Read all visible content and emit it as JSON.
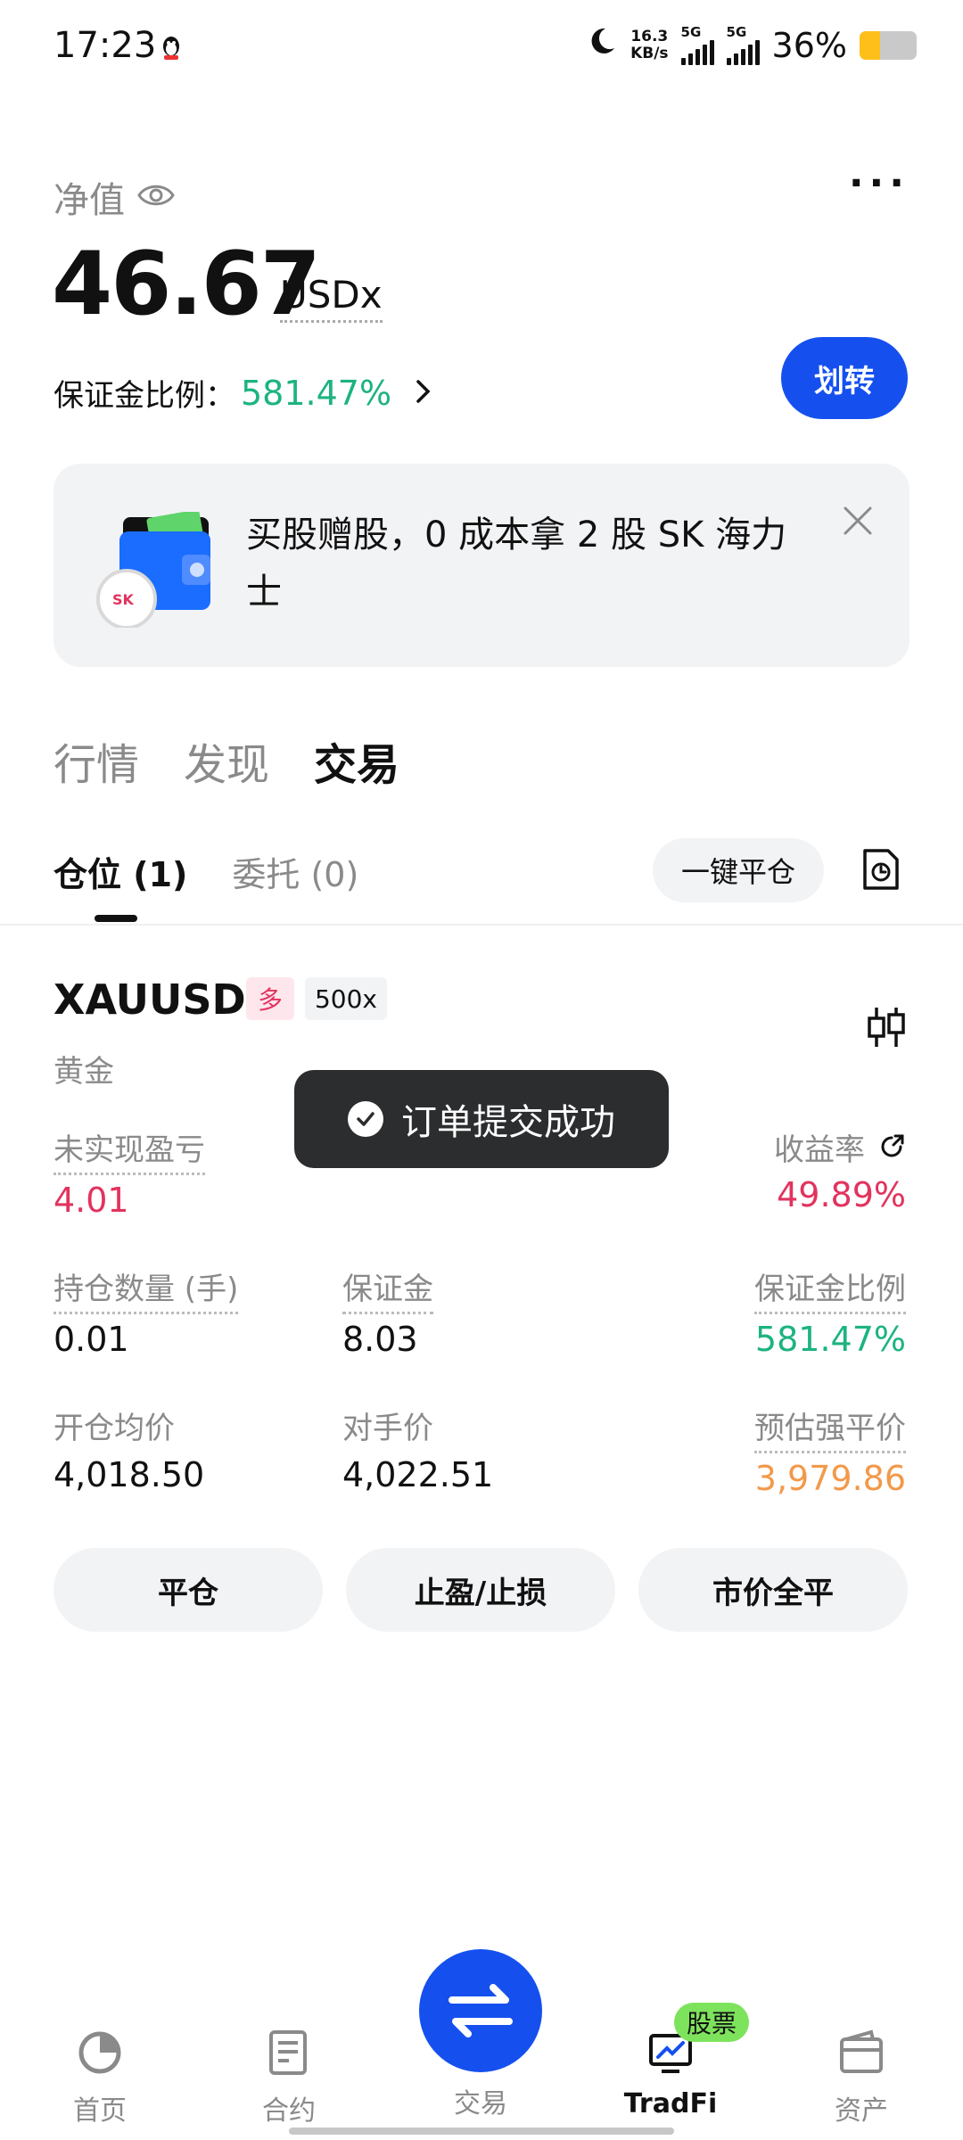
{
  "status_bar": {
    "time": "17:23",
    "speed_value": "16.3",
    "speed_unit": "KB/s",
    "network_1": "5G",
    "network_2": "5G",
    "battery": "36%",
    "battery_fraction": 0.36
  },
  "header": {
    "net_value_label": "净值",
    "balance": "46.67",
    "currency": "USDx",
    "margin_ratio_label": "保证金比例：",
    "margin_ratio_value": "581.47%",
    "transfer_button": "划转"
  },
  "banner": {
    "text": "买股赠股，0 成本拿 2 股 SK 海力士"
  },
  "main_tabs": [
    "行情",
    "发现",
    "交易"
  ],
  "main_tab_active": "交易",
  "sub_tabs": {
    "positions": "仓位 (1)",
    "orders": "委托 (0)",
    "close_all": "一键平仓"
  },
  "position": {
    "symbol": "XAUUSD",
    "side_tag": "多",
    "leverage": "500x",
    "name": "黄金",
    "unrealized_pnl_label": "未实现盈亏",
    "unrealized_pnl": "4.01",
    "roe_label": "收益率",
    "roe": "49.89%",
    "size_label": "持仓数量 (手)",
    "size": "0.01",
    "margin_label": "保证金",
    "margin": "8.03",
    "margin_ratio_label": "保证金比例",
    "margin_ratio": "581.47%",
    "entry_label": "开仓均价",
    "entry": "4,018.50",
    "mark_label": "对手价",
    "mark": "4,022.51",
    "liq_label": "预估强平价",
    "liq": "3,979.86"
  },
  "toast": "订单提交成功",
  "actions": {
    "close": "平仓",
    "tp_sl": "止盈/止损",
    "market_close_all": "市价全平"
  },
  "bottom_nav": {
    "home": "首页",
    "futures": "合约",
    "trade": "交易",
    "tradfi": "TradFi",
    "tradfi_badge": "股票",
    "assets": "资产"
  },
  "colors": {
    "accent": "#1550ef",
    "positive": "#1db380",
    "negative": "#e2335e",
    "warning": "#f2994a"
  }
}
